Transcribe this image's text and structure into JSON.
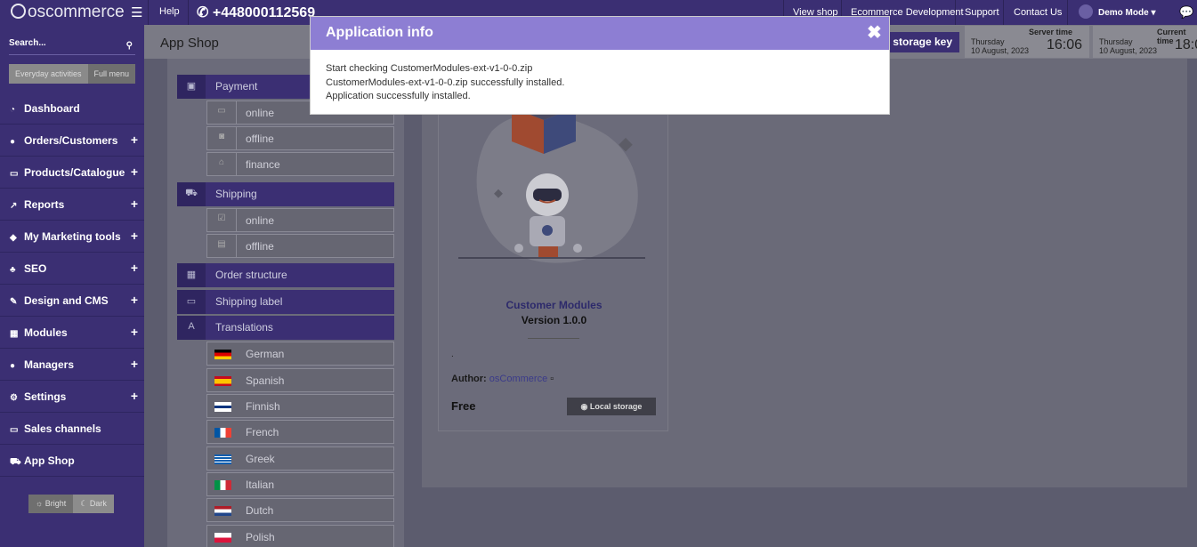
{
  "topbar": {
    "logo_text": "oscommerce",
    "help": "Help",
    "phone": "+448000112569",
    "links": [
      "View shop",
      "Ecommerce Development",
      "Support",
      "Contact Us"
    ],
    "user": "Demo Mode"
  },
  "sidebar": {
    "search_label": "Search...",
    "mode_buttons": [
      "Everyday activities",
      "Full menu"
    ],
    "items": [
      {
        "label": "Dashboard",
        "expandable": false
      },
      {
        "label": "Orders/Customers",
        "expandable": true
      },
      {
        "label": "Products/Catalogue",
        "expandable": true
      },
      {
        "label": "Reports",
        "expandable": true
      },
      {
        "label": "My Marketing tools",
        "expandable": true
      },
      {
        "label": "SEO",
        "expandable": true
      },
      {
        "label": "Design and CMS",
        "expandable": true
      },
      {
        "label": "Modules",
        "expandable": true
      },
      {
        "label": "Managers",
        "expandable": true
      },
      {
        "label": "Settings",
        "expandable": true
      },
      {
        "label": "Sales channels",
        "expandable": false
      },
      {
        "label": "App Shop",
        "expandable": false
      }
    ],
    "theme_buttons": [
      "Bright",
      "Dark"
    ]
  },
  "header": {
    "page_title": "App Shop",
    "storage_button": "y storage key",
    "server_time": {
      "label": "Server time",
      "day": "Thursday",
      "date": "10 August, 2023",
      "time": "16:06"
    },
    "current_time": {
      "label": "Current time",
      "day": "Thursday",
      "date": "10 August, 2023",
      "time": "18:0"
    }
  },
  "tree": {
    "payment": "Payment",
    "payment_items": [
      "online",
      "offline",
      "finance"
    ],
    "shipping": "Shipping",
    "shipping_items": [
      "online",
      "offline"
    ],
    "order_structure": "Order structure",
    "shipping_label": "Shipping label",
    "translations": "Translations",
    "languages": [
      "German",
      "Spanish",
      "Finnish",
      "French",
      "Greek",
      "Italian",
      "Dutch",
      "Polish"
    ]
  },
  "product": {
    "name": "Customer Modules",
    "version": "Version 1.0.0",
    "dot": ".",
    "author_label": "Author:",
    "author_name": "osCommerce",
    "price": "Free",
    "button": "Local storage"
  },
  "modal": {
    "title": "Application info",
    "lines": [
      "Start checking CustomerModules-ext-v1-0-0.zip",
      "CustomerModules-ext-v1-0-0.zip successfully installed.",
      "Application successfully installed."
    ]
  }
}
